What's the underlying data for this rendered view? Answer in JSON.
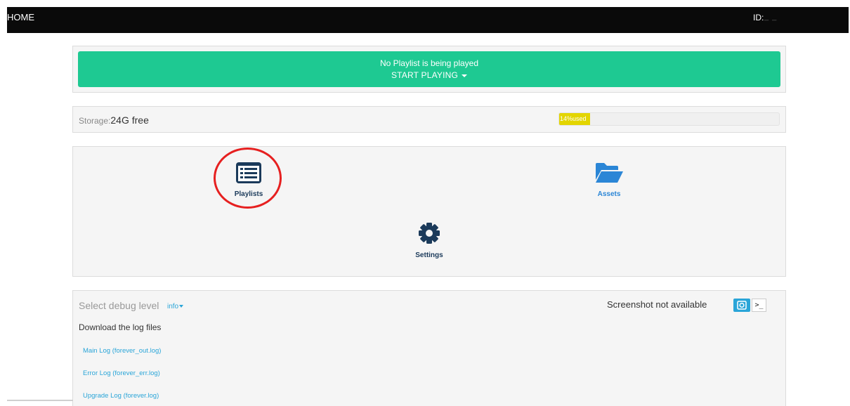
{
  "topbar": {
    "home": "HOME",
    "id_label": "ID:",
    "id_value": "_ _"
  },
  "player": {
    "status": "No Playlist is being played",
    "action": "START PLAYING",
    "color": "#1ec992"
  },
  "storage": {
    "label": "Storage:",
    "free": "24G free",
    "used_text": "14%used",
    "used_percent": 14,
    "bar_color": "#e3d500"
  },
  "menu": {
    "playlists": {
      "label": "Playlists",
      "icon": "list-icon"
    },
    "assets": {
      "label": "Assets",
      "icon": "folder-open-icon"
    },
    "settings": {
      "label": "Settings",
      "icon": "gear-icon"
    }
  },
  "debug": {
    "label": "Select debug level",
    "level": "info",
    "screenshot_status": "Screenshot not available",
    "terminal_label": ">_",
    "download_title": "Download the log files",
    "logs": [
      "Main Log (forever_out.log)",
      "Error Log (forever_err.log)",
      "Upgrade Log (forever.log)"
    ]
  }
}
